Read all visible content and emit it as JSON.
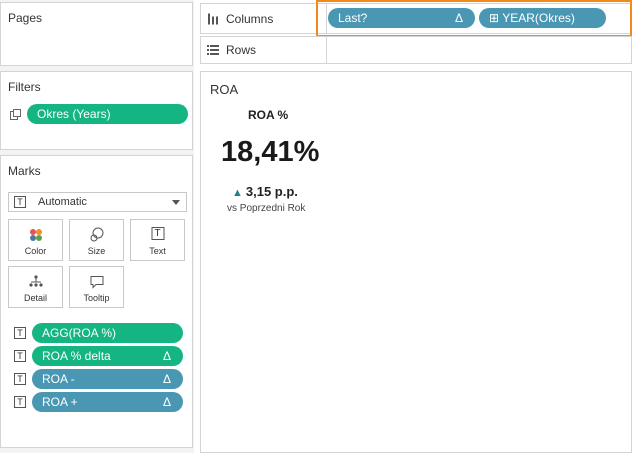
{
  "pages": {
    "title": "Pages"
  },
  "filters": {
    "title": "Filters",
    "items": [
      {
        "label": "Okres (Years)",
        "color": "#14b583"
      }
    ]
  },
  "marks": {
    "title": "Marks",
    "mark_type": "Automatic",
    "buttons": [
      {
        "label": "Color",
        "icon": "color-dots-icon"
      },
      {
        "label": "Size",
        "icon": "size-icon"
      },
      {
        "label": "Text",
        "icon": "text-icon"
      },
      {
        "label": "Detail",
        "icon": "detail-icon"
      },
      {
        "label": "Tooltip",
        "icon": "tooltip-icon"
      }
    ],
    "fields": [
      {
        "label": "AGG(ROA %)",
        "color": "#14b583",
        "delta": ""
      },
      {
        "label": "ROA % delta",
        "color": "#14b583",
        "delta": "Δ"
      },
      {
        "label": "ROA -",
        "color": "#4a97b4",
        "delta": "Δ"
      },
      {
        "label": "ROA +",
        "color": "#4a97b4",
        "delta": "Δ"
      }
    ]
  },
  "columns": {
    "label": "Columns",
    "pills": [
      {
        "label": "Last?",
        "delta": "Δ",
        "color": "#4a97b4"
      },
      {
        "label": "YEAR(Okres)",
        "prefix": "⊞",
        "color": "#4a97b4"
      }
    ]
  },
  "rows": {
    "label": "Rows"
  },
  "view": {
    "sheet_title": "ROA",
    "kpi_label": "ROA %",
    "kpi_value": "18,41%",
    "kpi_delta_arrow": "▲",
    "kpi_delta": "3,15 p.p.",
    "kpi_sub": "vs Poprzedni Rok"
  },
  "colors": {
    "highlight": "#f28a1b",
    "green_pill": "#14b583",
    "blue_pill": "#4a97b4",
    "kpi_arrow": "#2a7f87"
  }
}
